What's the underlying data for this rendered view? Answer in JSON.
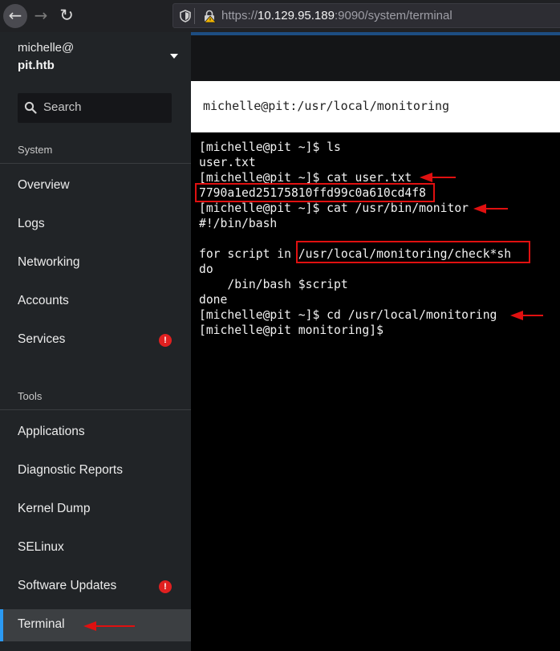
{
  "browser": {
    "url_scheme": "https://",
    "url_host": "10.129.95.189",
    "url_rest": ":9090/system/terminal"
  },
  "sidebar": {
    "user": "michelle@",
    "host": "pit.htb",
    "search_placeholder": "Search",
    "system_label": "System",
    "tools_label": "Tools",
    "system_items": [
      {
        "label": "Overview"
      },
      {
        "label": "Logs"
      },
      {
        "label": "Networking"
      },
      {
        "label": "Accounts"
      },
      {
        "label": "Services",
        "alert": "!"
      }
    ],
    "tool_items": [
      {
        "label": "Applications"
      },
      {
        "label": "Diagnostic Reports"
      },
      {
        "label": "Kernel Dump"
      },
      {
        "label": "SELinux"
      },
      {
        "label": "Software Updates",
        "alert": "!"
      },
      {
        "label": "Terminal",
        "active": true
      }
    ]
  },
  "terminal": {
    "title": "michelle@pit:/usr/local/monitoring",
    "lines": [
      "[michelle@pit ~]$ ls",
      "user.txt",
      "[michelle@pit ~]$ cat user.txt",
      "7790a1ed25175810ffd99c0a610cd4f8",
      "[michelle@pit ~]$ cat /usr/bin/monitor",
      "#!/bin/bash",
      "",
      "for script in /usr/local/monitoring/check*sh",
      "do",
      "    /bin/bash $script",
      "done",
      "[michelle@pit ~]$ cd /usr/local/monitoring",
      "[michelle@pit monitoring]$"
    ]
  },
  "colors": {
    "annotation": "#e01010",
    "active_nav_accent": "#2b9af3",
    "sidebar_bg": "#212427",
    "alert": "#e02020"
  }
}
